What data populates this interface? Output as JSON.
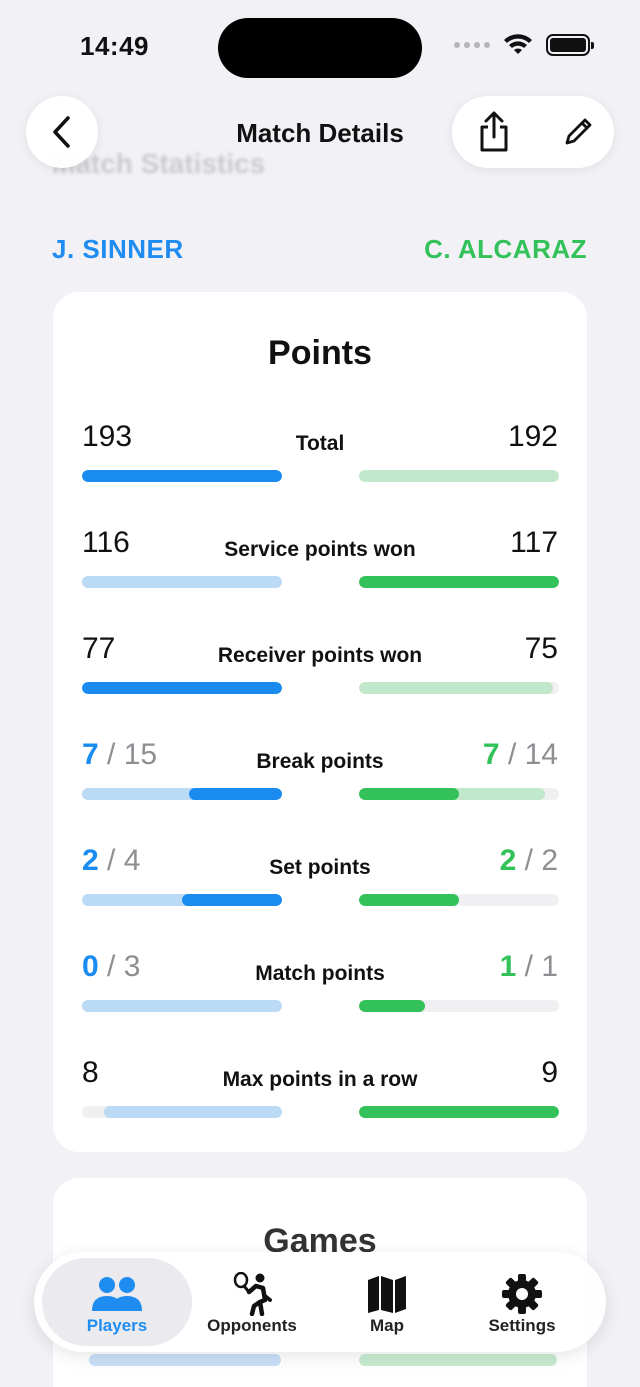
{
  "status_bar": {
    "time": "14:49"
  },
  "nav": {
    "title": "Match Details",
    "ghost_title": "Match Statistics"
  },
  "players": {
    "left": "J. SINNER",
    "right": "C. ALCARAZ"
  },
  "colors": {
    "blue": "#1a8cf0",
    "light_blue": "#badaf6",
    "green": "#33c25a",
    "light_green": "#c2e8cc",
    "track": "#f0f0f2"
  },
  "points": {
    "title": "Points",
    "rows": [
      {
        "label": "Total",
        "left_value": "193",
        "right_value": "192",
        "left_fill": 1.0,
        "left_strong": true,
        "right_fill": 1.0,
        "right_strong": false
      },
      {
        "label": "Service points won",
        "left_value": "116",
        "right_value": "117",
        "left_fill": 1.0,
        "left_strong": false,
        "right_fill": 1.0,
        "right_strong": true
      },
      {
        "label": "Receiver points won",
        "left_value": "77",
        "right_value": "75",
        "left_fill": 1.0,
        "left_strong": true,
        "right_fill": 0.97,
        "right_strong": false
      },
      {
        "label": "Break points",
        "left_won": "7",
        "left_total": "15",
        "right_won": "7",
        "right_total": "14"
      },
      {
        "label": "Set points",
        "left_won": "2",
        "left_total": "4",
        "right_won": "2",
        "right_total": "2"
      },
      {
        "label": "Match points",
        "left_won": "0",
        "left_total": "3",
        "right_won": "1",
        "right_total": "1"
      },
      {
        "label": "Max points in a row",
        "left_value": "8",
        "right_value": "9",
        "left_fill": 0.89,
        "left_strong": false,
        "right_fill": 1.0,
        "right_strong": true
      }
    ]
  },
  "games": {
    "title": "Games"
  },
  "tabs": [
    {
      "label": "Players",
      "icon": "players-icon",
      "active": true
    },
    {
      "label": "Opponents",
      "icon": "opponents-icon",
      "active": false
    },
    {
      "label": "Map",
      "icon": "map-icon",
      "active": false
    },
    {
      "label": "Settings",
      "icon": "gear-icon",
      "active": false
    }
  ]
}
